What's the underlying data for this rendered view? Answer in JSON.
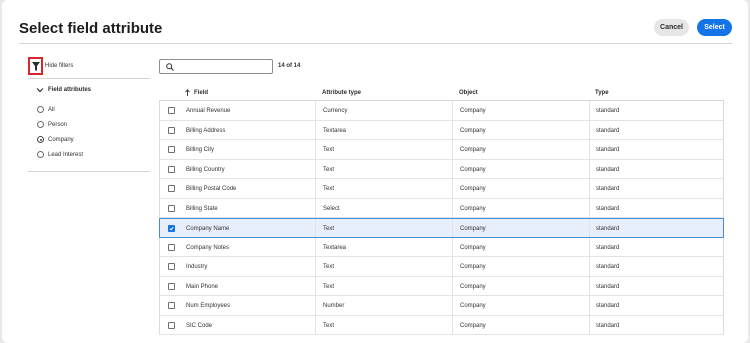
{
  "dialog": {
    "title": "Select field attribute",
    "cancel_label": "Cancel",
    "select_label": "Select"
  },
  "filters": {
    "toggle_icon": "filter-icon",
    "hide_label": "Hide filters",
    "group_label": "Field attributes",
    "options": [
      {
        "label": "All",
        "checked": false
      },
      {
        "label": "Person",
        "checked": false
      },
      {
        "label": "Company",
        "checked": true
      },
      {
        "label": "Lead Interest",
        "checked": false
      }
    ]
  },
  "search": {
    "placeholder": "",
    "value": "",
    "count_text": "14 of 14"
  },
  "table": {
    "columns": [
      "Field",
      "Attribute type",
      "Object",
      "Type"
    ],
    "sort_column": "Field",
    "rows": [
      {
        "field": "Annual Revenue",
        "attribute_type": "Currency",
        "object": "Company",
        "type": "standard",
        "checked": false
      },
      {
        "field": "Billing Address",
        "attribute_type": "Textarea",
        "object": "Company",
        "type": "standard",
        "checked": false
      },
      {
        "field": "Billing City",
        "attribute_type": "Text",
        "object": "Company",
        "type": "standard",
        "checked": false
      },
      {
        "field": "Billing Country",
        "attribute_type": "Text",
        "object": "Company",
        "type": "standard",
        "checked": false
      },
      {
        "field": "Billing Postal Code",
        "attribute_type": "Text",
        "object": "Company",
        "type": "standard",
        "checked": false
      },
      {
        "field": "Billing State",
        "attribute_type": "Select",
        "object": "Company",
        "type": "standard",
        "checked": false
      },
      {
        "field": "Company Name",
        "attribute_type": "Text",
        "object": "Company",
        "type": "standard",
        "checked": true
      },
      {
        "field": "Company Notes",
        "attribute_type": "Textarea",
        "object": "Company",
        "type": "standard",
        "checked": false
      },
      {
        "field": "Industry",
        "attribute_type": "Text",
        "object": "Company",
        "type": "standard",
        "checked": false
      },
      {
        "field": "Main Phone",
        "attribute_type": "Text",
        "object": "Company",
        "type": "standard",
        "checked": false
      },
      {
        "field": "Num Employees",
        "attribute_type": "Number",
        "object": "Company",
        "type": "standard",
        "checked": false
      },
      {
        "field": "SIC Code",
        "attribute_type": "Text",
        "object": "Company",
        "type": "standard",
        "checked": false
      }
    ]
  }
}
